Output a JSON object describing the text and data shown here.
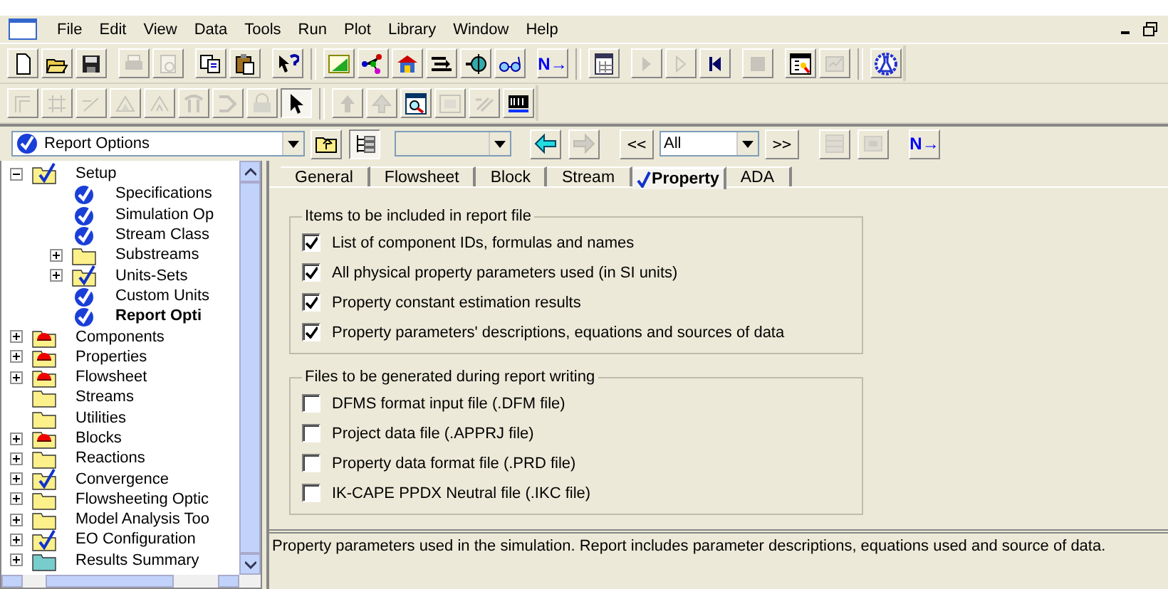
{
  "menu": [
    "File",
    "Edit",
    "View",
    "Data",
    "Tools",
    "Run",
    "Plot",
    "Library",
    "Window",
    "Help"
  ],
  "toolbar_1": [
    {
      "disabled": false
    },
    {
      "disabled": false
    },
    {
      "disabled": false
    },
    {
      "disabled": true
    },
    {
      "disabled": true
    },
    {
      "disabled": false
    },
    {
      "disabled": false
    },
    {
      "disabled": false
    },
    {
      "disabled": false
    },
    {
      "disabled": false
    },
    {
      "disabled": false
    },
    {
      "disabled": false
    },
    {
      "disabled": false
    },
    {
      "disabled": false
    },
    {
      "disabled": false,
      "label": "N→"
    },
    {
      "disabled": false
    },
    {
      "disabled": true
    },
    {
      "disabled": true
    },
    {
      "disabled": false
    },
    {
      "disabled": true
    },
    {
      "disabled": false
    },
    {
      "disabled": true
    },
    {
      "disabled": false
    }
  ],
  "toolbar_2": [
    {
      "disabled": true
    },
    {
      "disabled": true
    },
    {
      "disabled": true
    },
    {
      "disabled": true
    },
    {
      "disabled": true
    },
    {
      "disabled": true
    },
    {
      "disabled": true
    },
    {
      "disabled": true
    },
    {
      "disabled": false,
      "selected": true
    },
    {
      "disabled": true
    },
    {
      "disabled": true
    },
    {
      "disabled": false
    },
    {
      "disabled": true
    },
    {
      "disabled": true
    },
    {
      "disabled": false
    }
  ],
  "navigator": {
    "form_selector": "Report Options",
    "filter": "All",
    "previous_label": "<<",
    "next_form_label": ">>",
    "next_label": "N→",
    "back_disabled": false,
    "forward_disabled": true
  },
  "tree": [
    {
      "label": "Setup",
      "kind": "checked-folder",
      "expanded": true,
      "selected": false,
      "children": [
        {
          "label": "Specifications",
          "kind": "form",
          "selected": false
        },
        {
          "label": "Simulation Op",
          "kind": "form",
          "selected": false
        },
        {
          "label": "Stream Class",
          "kind": "form",
          "selected": false
        },
        {
          "label": "Substreams",
          "kind": "folder",
          "expanded": false,
          "selected": false
        },
        {
          "label": "Units-Sets",
          "kind": "checked-folder",
          "expanded": false,
          "selected": false
        },
        {
          "label": "Custom Units",
          "kind": "form",
          "selected": false
        },
        {
          "label": "Report Opti",
          "kind": "form",
          "selected": true
        }
      ]
    },
    {
      "label": "Components",
      "kind": "alert-folder",
      "expanded": false,
      "selected": false
    },
    {
      "label": "Properties",
      "kind": "alert-folder",
      "expanded": false,
      "selected": false
    },
    {
      "label": "Flowsheet",
      "kind": "alert-folder",
      "expanded": false,
      "selected": false
    },
    {
      "label": "Streams",
      "kind": "folder",
      "selected": false
    },
    {
      "label": "Utilities",
      "kind": "folder",
      "selected": false
    },
    {
      "label": "Blocks",
      "kind": "alert-folder",
      "expanded": false,
      "selected": false
    },
    {
      "label": "Reactions",
      "kind": "folder",
      "expanded": false,
      "selected": false
    },
    {
      "label": "Convergence",
      "kind": "checked-folder",
      "expanded": false,
      "selected": false
    },
    {
      "label": "Flowsheeting Optic",
      "kind": "folder",
      "expanded": false,
      "selected": false
    },
    {
      "label": "Model Analysis Too",
      "kind": "folder",
      "expanded": false,
      "selected": false
    },
    {
      "label": "EO Configuration",
      "kind": "checked-folder",
      "expanded": false,
      "selected": false
    },
    {
      "label": "Results Summary",
      "kind": "results-folder",
      "expanded": false,
      "selected": false
    }
  ],
  "tabs": [
    {
      "label": "General",
      "selected": false,
      "complete": false
    },
    {
      "label": "Flowsheet",
      "selected": false,
      "complete": false
    },
    {
      "label": "Block",
      "selected": false,
      "complete": false
    },
    {
      "label": "Stream",
      "selected": false,
      "complete": false
    },
    {
      "label": "Property",
      "selected": true,
      "complete": true
    },
    {
      "label": "ADA",
      "selected": false,
      "complete": false
    }
  ],
  "groups": [
    {
      "title": "Items to be included in report file",
      "options": [
        {
          "label": "List of component IDs, formulas and names",
          "checked": true
        },
        {
          "label": "All physical property parameters used (in SI units)",
          "checked": true
        },
        {
          "label": "Property constant estimation results",
          "checked": true
        },
        {
          "label": "Property parameters' descriptions, equations and sources of data",
          "checked": true
        }
      ]
    },
    {
      "title": "Files to be generated during report writing",
      "options": [
        {
          "label": "DFMS format input file (.DFM file)",
          "checked": false
        },
        {
          "label": "Project data file (.APPRJ file)",
          "checked": false
        },
        {
          "label": "Property data format file (.PRD file)",
          "checked": false
        },
        {
          "label": "IK-CAPE PPDX Neutral file (.IKC file)",
          "checked": false
        }
      ]
    }
  ],
  "description": "Property parameters used in the simulation. Report includes parameter descriptions, equations used and source of data."
}
